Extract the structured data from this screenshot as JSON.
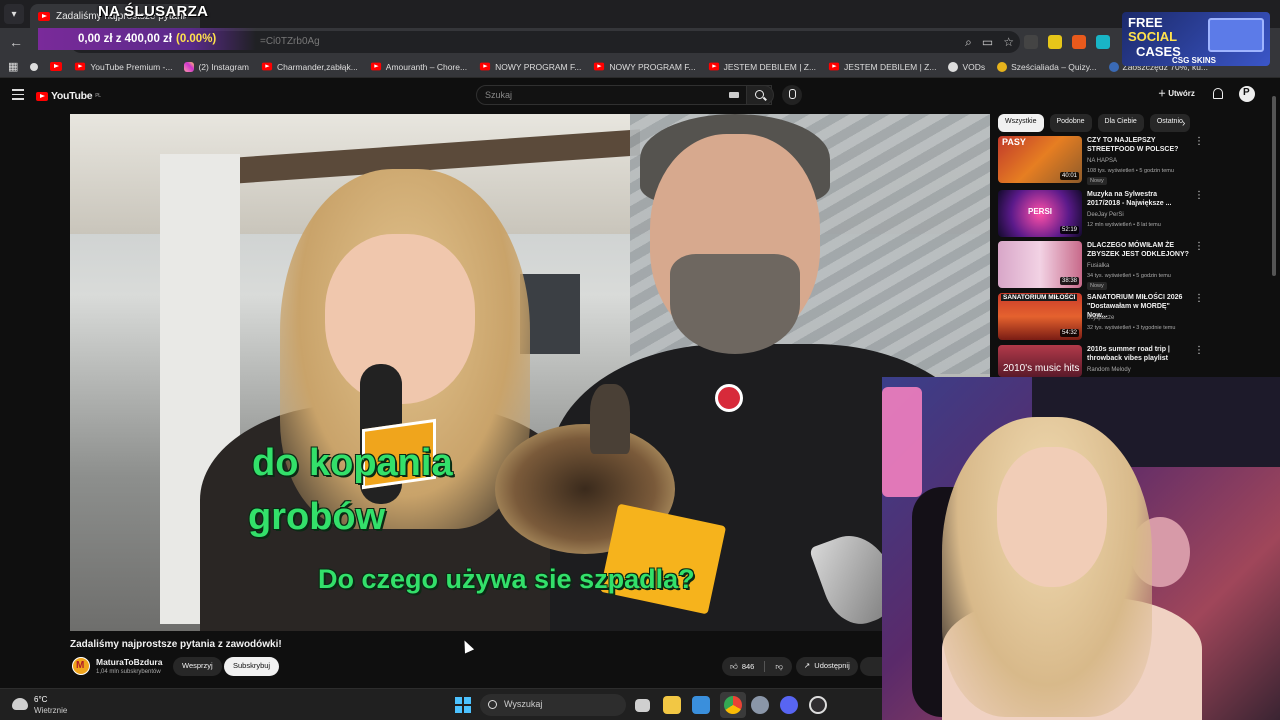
{
  "browser": {
    "tab_title": "Zadaliśmy najprostsze pytania z zawodówki!",
    "url_fragment": "=Ci0TZrb0Ag",
    "bookmarks": [
      "YouTube Premium -...",
      "(2) Instagram",
      "Charmander,zabłąk...",
      "Amouranth – Chore...",
      "NOWY PROGRAM F...",
      "NOWY PROGRAM F...",
      "JESTEM DEBILEM | Z...",
      "JESTEM DEBILEM | Z...",
      "VODs",
      "Sześcialiada – Quizy...",
      "Zaoszczędź 70%, ku..."
    ]
  },
  "stream_overlay": {
    "title": "NA ŚLUSARZA",
    "donation_amount": "0,00 zł z 400,00 zł",
    "donation_pct": "(0.00%)",
    "ad_line1": "FREE",
    "ad_line2": "SOCIAL",
    "ad_line3": "CASES",
    "ad_brand": "CSG SKINS"
  },
  "youtube": {
    "logo": "YouTube",
    "logo_region": "PL",
    "search_placeholder": "Szukaj",
    "create_label": "Utwórz",
    "video": {
      "caption1": "do kopania",
      "caption2": "grobów",
      "caption3": "Do czego używa sie szpadla?",
      "title": "Zadaliśmy najprostsze pytania z zawodówki!",
      "channel": "MaturaToBzdura",
      "subscribers": "1,04 mln subskrybentów",
      "support_label": "Wesprzyj",
      "subscribe_label": "Subskrybuj",
      "likes": "846",
      "share_label": "Udostępnij"
    },
    "chips": [
      "Wszystkie",
      "Podobne",
      "Dla Ciebie",
      "Ostatnio"
    ],
    "recommendations": [
      {
        "title": "CZY TO NAJLEPSZY STREETFOOD W POLSCE?",
        "channel": "NA HAPSA",
        "meta": "108 tys. wyświetleń • 5 godzin temu",
        "badge": "Nowy",
        "duration": "40:01",
        "thumb_text": "PASY"
      },
      {
        "title": "Muzyka na Sylwestra 2017/2018 - Największe ...",
        "channel": "DeeJay PerSi",
        "meta": "12 mln wyświetleń • 8 lat temu",
        "badge": "",
        "duration": "52:19",
        "thumb_text": "PERSI"
      },
      {
        "title": "DLACZEGO MÓWIŁAM ŻE ZBYSZEK JEST ODKLEJONY?",
        "channel": "Fusialka",
        "meta": "34 tys. wyświetleń • 5 godzin temu",
        "badge": "Nowy",
        "duration": "38:38",
        "thumb_text": ""
      },
      {
        "title": "SANATORIUM MIŁOŚCI 2026 \"Dostawałam w MORDĘ\" Now...",
        "channel": "oojapacze",
        "meta": "32 tys. wyświetleń • 3 tygodnie temu",
        "badge": "",
        "duration": "54:32",
        "thumb_text": "SANATORIUM MIŁOŚCI"
      },
      {
        "title": "2010s summer road trip | throwback vibes playlist",
        "channel": "Random Melody",
        "meta": "",
        "badge": "",
        "duration": "",
        "thumb_text": "2010's music hits"
      }
    ]
  },
  "taskbar": {
    "temperature": "6°C",
    "weather": "Wietrznie",
    "search_label": "Wyszukaj"
  }
}
